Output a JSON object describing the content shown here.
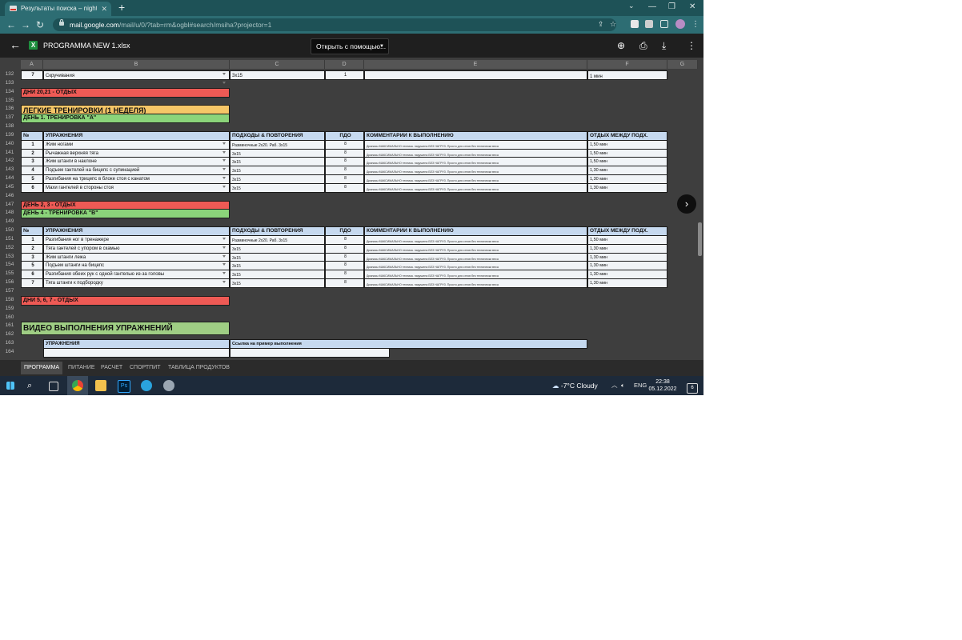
{
  "browser": {
    "tab_title": "Результаты поиска – nightcrawle",
    "url_host": "mail.google.com",
    "url_path": "/mail/u/0/?tab=rm&ogbl#search/msiha?projector=1",
    "accent": "#2d6d73"
  },
  "viewer": {
    "file_name": "PROGRAMMA NEW 1.xlsx",
    "open_with_label": "Открыть с помощью...",
    "file_icon_letter": "X"
  },
  "sheet": {
    "columns": [
      "A",
      "B",
      "C",
      "D",
      "E",
      "F",
      "G"
    ],
    "row_numbers": [
      "132",
      "133",
      "134",
      "135",
      "136",
      "137",
      "138",
      "139",
      "140",
      "141",
      "142",
      "143",
      "144",
      "145",
      "146",
      "147",
      "148",
      "149",
      "150",
      "151",
      "152",
      "153",
      "154",
      "155",
      "156",
      "157",
      "158",
      "159",
      "160",
      "161",
      "162",
      "163",
      "164"
    ],
    "row132": {
      "num": "7",
      "exercise": "Скручивания",
      "sets": "3x15",
      "pdo": "1",
      "rest": "1 мин"
    },
    "rest_block_1": "ДНИ 20,21 - ОТДЫХ",
    "light_title": "ЛЕГКИЕ ТРЕНИРОВКИ (1 НЕДЕЛЯ)",
    "day1_title": "ДЕНЬ 1. ТРЕНИРОВКА \"А\"",
    "headers": {
      "num": "№",
      "exercise": "УПРАЖНЕНИЯ",
      "sets": "ПОДХОДЫ & ПОВТОРЕНИЯ",
      "pdo": "ПДО",
      "comments": "КОММЕНТАРИИ К ВЫПОЛНЕНИЮ",
      "rest": "ОТДЫХ МЕЖДУ ПОДХ."
    },
    "day1_rows": [
      {
        "num": "1",
        "exercise": "Жим ногами",
        "sets": "Разминочные 2х20. Раб. 3х15",
        "pdo": "8",
        "comment": "Диапазы МАКСИМАЛЬНО техника. нарушена БЕЗ НАГРУЗ. Просто для сэтов без технически веса",
        "rest": "1,50 мин"
      },
      {
        "num": "2",
        "exercise": "Рычажная верхняя тяга",
        "sets": "3х15",
        "pdo": "8",
        "comment": "Диапазы МАКСИМАЛЬНО техника. нарушена БЕЗ НАГРУЗ. Просто для сэтов без технически веса",
        "rest": "1,50 мин"
      },
      {
        "num": "3",
        "exercise": "Жим штанги в наклоне",
        "sets": "3х15",
        "pdo": "8",
        "comment": "Диапазы МАКСИМАЛЬНО техника. нарушена БЕЗ НАГРУЗ. Просто для сэтов без технически веса",
        "rest": "1,50 мин"
      },
      {
        "num": "4",
        "exercise": "Подъем гантелей на бицепс с супинацией",
        "sets": "3х15",
        "pdo": "8",
        "comment": "Диапазы МАКСИМАЛЬНО техника. нарушена БЕЗ НАГРУЗ. Просто для сэтов без технически веса",
        "rest": "1,30 мин"
      },
      {
        "num": "5",
        "exercise": "Разгибания на трицепс в блоке стоя с канатом",
        "sets": "3х15",
        "pdo": "8",
        "comment": "Диапазы МАКСИМАЛЬНО техника. нарушена БЕЗ НАГРУЗ. Просто для сэтов без технически веса",
        "rest": "1,30 мин"
      },
      {
        "num": "6",
        "exercise": "Махи гантелей в стороны стоя",
        "sets": "3х15",
        "pdo": "8",
        "comment": "Диапазы МАКСИМАЛЬНО техника. нарушена БЕЗ НАГРУЗ. Просто для сэтов без технически веса",
        "rest": "1,30 мин"
      }
    ],
    "rest_block_2": "ДЕНЬ 2, 3 - ОТДЫХ",
    "day4_title": "ДЕНЬ 4 - ТРЕНИРОВКА \"В\"",
    "day4_rows": [
      {
        "num": "1",
        "exercise": "Разгибания ног в тренажере",
        "sets": "Разминочные 2х20. Раб. 3х15",
        "pdo": "8",
        "comment": "Диапазы МАКСИМАЛЬНО техника. нарушена БЕЗ НАГРУЗ. Просто для сэтов без технически веса",
        "rest": "1,50 мин"
      },
      {
        "num": "2",
        "exercise": "Тяга гантелей с упором в скамью",
        "sets": "3х15",
        "pdo": "8",
        "comment": "Диапазы МАКСИМАЛЬНО техника. нарушена БЕЗ НАГРУЗ. Просто для сэтов без технически веса",
        "rest": "1,30 мин"
      },
      {
        "num": "3",
        "exercise": "Жим штанги лежа",
        "sets": "3х15",
        "pdo": "8",
        "comment": "Диапазы МАКСИМАЛЬНО техника. нарушена БЕЗ НАГРУЗ. Просто для сэтов без технически веса",
        "rest": "1,30 мин"
      },
      {
        "num": "5",
        "exercise": "Подъем штанги на бицепс",
        "sets": "3х15",
        "pdo": "8",
        "comment": "Диапазы МАКСИМАЛЬНО техника. нарушена БЕЗ НАГРУЗ. Просто для сэтов без технически веса",
        "rest": "1,30 мин"
      },
      {
        "num": "6",
        "exercise": "Разгибания обеих рук с одной гантелью из-за головы",
        "sets": "3х15",
        "pdo": "8",
        "comment": "Диапазы МАКСИМАЛЬНО техника. нарушена БЕЗ НАГРУЗ. Просто для сэтов без технически веса",
        "rest": "1,30 мин"
      },
      {
        "num": "7",
        "exercise": "Тяга штанги к подбородку",
        "sets": "3х15",
        "pdo": "8",
        "comment": "Диапазы МАКСИМАЛЬНО техника. нарушена БЕЗ НАГРУЗ. Просто для сэтов без технически веса",
        "rest": "1,30 мин"
      }
    ],
    "rest_block_3": "ДНИ 5, 6, 7 - ОТДЫХ",
    "video_title": "ВИДЕО ВЫПОЛНЕНИЯ УПРАЖНЕНИЙ",
    "video_headers": {
      "exercise": "УПРАЖНЕНИЯ",
      "link": "Ссылка на пример выполнения"
    }
  },
  "sheet_tabs": [
    "ПРОГРАММА",
    "ПИТАНИЕ",
    "РАСЧЕТ",
    "СПОРТПИТ",
    "ТАБЛИЦА ПРОДУКТОВ"
  ],
  "taskbar": {
    "weather": "-7°C  Cloudy",
    "lang": "ENG",
    "time": "22:38",
    "date": "05.12.2022",
    "notifications": "6"
  }
}
